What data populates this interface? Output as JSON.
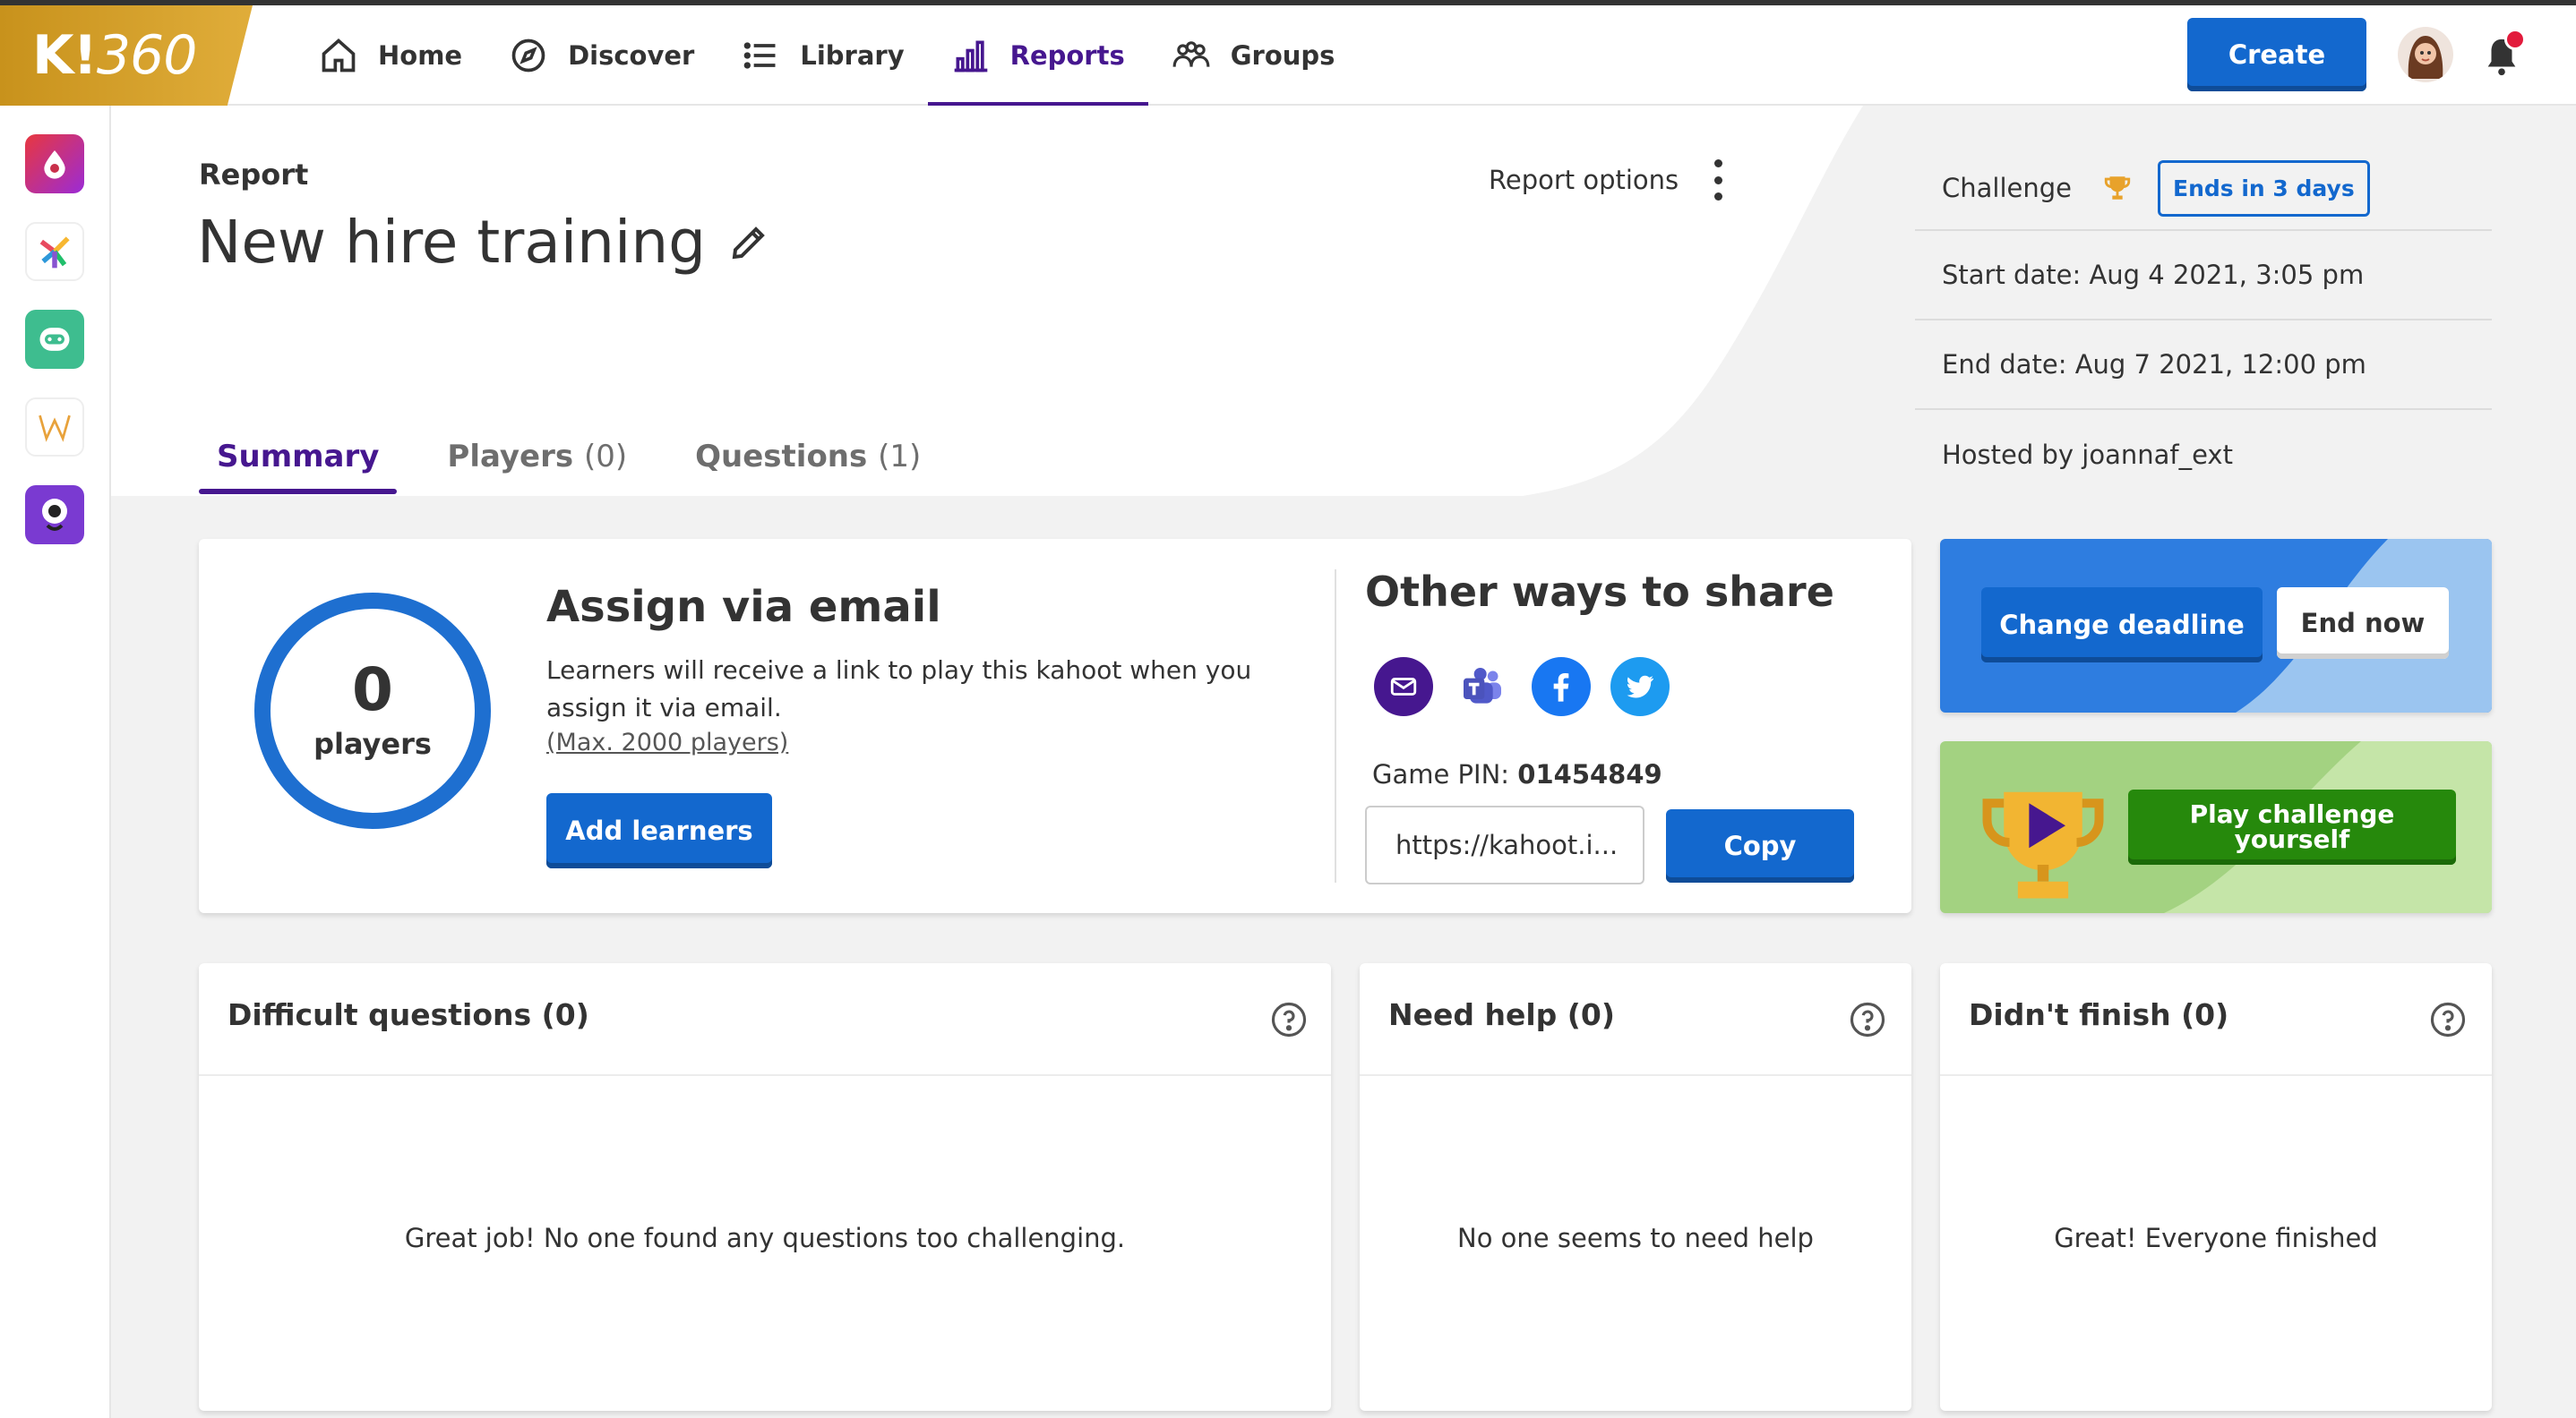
{
  "header": {
    "logo_k": "K!",
    "logo_360": "360",
    "nav": [
      {
        "label": "Home",
        "icon": "home-icon"
      },
      {
        "label": "Discover",
        "icon": "compass-icon"
      },
      {
        "label": "Library",
        "icon": "list-icon"
      },
      {
        "label": "Reports",
        "icon": "bar-chart-icon",
        "active": true
      },
      {
        "label": "Groups",
        "icon": "people-icon"
      }
    ],
    "create_label": "Create"
  },
  "report": {
    "label": "Report",
    "title": "New hire training",
    "options_label": "Report options"
  },
  "tabs": [
    {
      "label": "Summary",
      "count": "",
      "active": true
    },
    {
      "label": "Players",
      "count": "(0)"
    },
    {
      "label": "Questions",
      "count": "(1)"
    }
  ],
  "challenge": {
    "label": "Challenge",
    "ends_badge": "Ends in 3 days",
    "start_date": "Start date: Aug 4 2021, 3:05 pm",
    "end_date": "End date: Aug 7 2021, 12:00 pm",
    "hosted_by": "Hosted by joannaf_ext"
  },
  "assign": {
    "players_count": "0",
    "players_label": "players",
    "title": "Assign via email",
    "description": "Learners will receive a link to play this kahoot when you assign it via email.",
    "max_note": "(Max. 2000 players)",
    "add_button": "Add learners"
  },
  "share": {
    "title": "Other ways to share",
    "icons": [
      "email-icon",
      "teams-icon",
      "facebook-icon",
      "twitter-icon"
    ],
    "pin_label": "Game PIN:",
    "pin_value": "01454849",
    "url_value": "https://kahoot.i...",
    "copy_button": "Copy"
  },
  "deadline": {
    "change_button": "Change deadline",
    "end_button": "End now"
  },
  "play": {
    "button": "Play challenge yourself"
  },
  "panels": [
    {
      "title": "Difficult questions (0)",
      "message": "Great job! No one found any questions too challenging."
    },
    {
      "title": "Need help (0)",
      "message": "No one seems to need help"
    },
    {
      "title": "Didn't finish (0)",
      "message": "Great! Everyone finished"
    }
  ],
  "colors": {
    "accent_purple": "#46178f",
    "primary_blue": "#1368ce",
    "green": "#26890c",
    "gold": "#d89e1e"
  }
}
